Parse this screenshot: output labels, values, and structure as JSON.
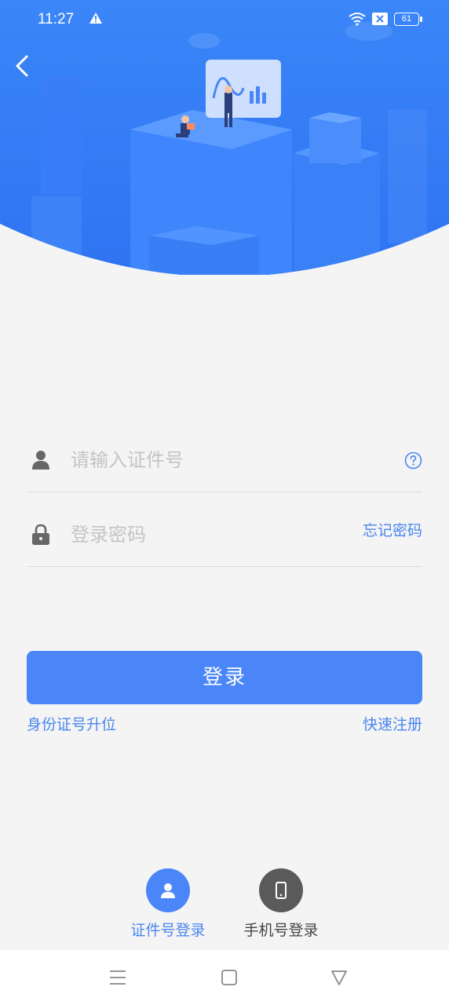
{
  "status_bar": {
    "time": "11:27",
    "battery": "61"
  },
  "header": {
    "back_icon": "chevron-left-icon"
  },
  "form": {
    "id_number": {
      "value": "",
      "placeholder": "请输入证件号",
      "icon": "user-icon",
      "help_icon": "question-circle-icon"
    },
    "password": {
      "value": "",
      "placeholder": "登录密码",
      "icon": "lock-icon",
      "forgot_label": "忘记密码"
    },
    "login_label": "登录",
    "id_upgrade_label": "身份证号升位",
    "quick_register_label": "快速注册"
  },
  "login_modes": [
    {
      "label": "证件号登录",
      "icon": "user-icon",
      "active": true
    },
    {
      "label": "手机号登录",
      "icon": "phone-icon",
      "active": false
    }
  ],
  "colors": {
    "accent": "#4a86f7",
    "link": "#4a86f0",
    "hero": "#3d82f6",
    "background": "#f4f4f4"
  },
  "nav_bar": {
    "menu_icon": "menu-icon",
    "home_icon": "square-home-icon",
    "back_icon": "triangle-back-icon"
  }
}
